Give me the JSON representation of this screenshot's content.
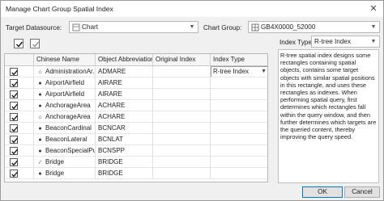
{
  "window": {
    "title": "Manage Chart Group Spatial Index",
    "close_glyph": "✕"
  },
  "datasource": {
    "label": "Target Datasource:",
    "value": "Chart",
    "icon": "datasource-icon"
  },
  "chart_group": {
    "label": "Chart Group:",
    "value": "GB4X0000_52000",
    "icon": "chart-group-icon"
  },
  "toolbar": {
    "select_all_icon": "select-all-checkbox-icon",
    "select_invert_icon": "select-invert-checkbox-icon"
  },
  "index_type": {
    "label": "Index Type:",
    "value": "R-tree Index"
  },
  "table": {
    "columns": [
      "",
      "Chinese Name",
      "Object Abbreviation",
      "Original Index",
      "Index Type"
    ],
    "rows": [
      {
        "checked": true,
        "geo": "region",
        "name": "AdministrationAr...",
        "abbr": "ADMARE",
        "original": "",
        "index_type": "R-tree Index",
        "active": true
      },
      {
        "checked": true,
        "geo": "point",
        "name": "AirportAirfield",
        "abbr": "AIRARE",
        "original": "",
        "index_type": ""
      },
      {
        "checked": true,
        "geo": "point",
        "name": "AirportAirfield",
        "abbr": "AIRARE",
        "original": "",
        "index_type": ""
      },
      {
        "checked": true,
        "geo": "point",
        "name": "AnchorageArea",
        "abbr": "ACHARE",
        "original": "",
        "index_type": ""
      },
      {
        "checked": true,
        "geo": "region",
        "name": "AnchorageArea",
        "abbr": "ACHARE",
        "original": "",
        "index_type": ""
      },
      {
        "checked": true,
        "geo": "point",
        "name": "BeaconCardinal",
        "abbr": "BCNCAR",
        "original": "",
        "index_type": ""
      },
      {
        "checked": true,
        "geo": "point",
        "name": "BeaconLateral",
        "abbr": "BCNLAT",
        "original": "",
        "index_type": ""
      },
      {
        "checked": true,
        "geo": "point",
        "name": "BeaconSpecialPu...",
        "abbr": "BCNSPP",
        "original": "",
        "index_type": ""
      },
      {
        "checked": true,
        "geo": "line",
        "name": "Bridge",
        "abbr": "BRIDGE",
        "original": "",
        "index_type": ""
      },
      {
        "checked": true,
        "geo": "point",
        "name": "Bridge",
        "abbr": "BRIDGE",
        "original": "",
        "index_type": ""
      }
    ]
  },
  "description": "R-tree spatial index designs some rectangles containing spatial objects, contains some target objects with similar spatial positions in this rectangle, and uses these rectangles as indexes. When performing spatial query, first determines which rectangles fall within the query window, and then further determines which targets are the queried content, thereby improving the query speed.",
  "buttons": {
    "ok": "OK",
    "cancel": "Cancel"
  }
}
